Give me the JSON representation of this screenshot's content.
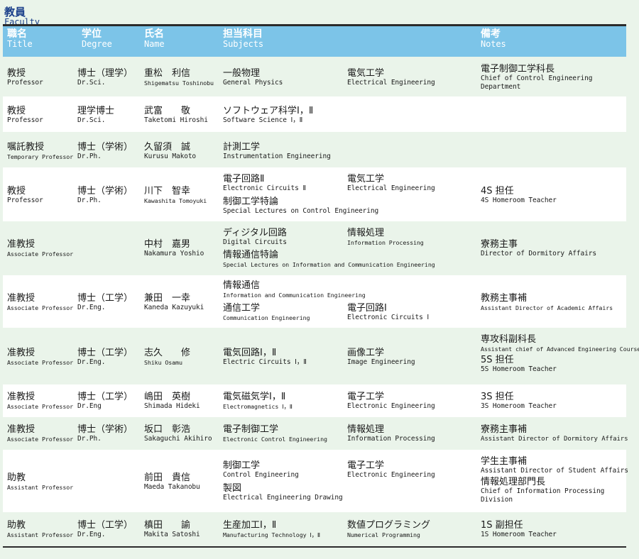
{
  "heading": {
    "ja": "教員",
    "en": "Faculty"
  },
  "columns": [
    {
      "ja": "職名",
      "en": "Title"
    },
    {
      "ja": "学位",
      "en": "Degree"
    },
    {
      "ja": "氏名",
      "en": "Name"
    },
    {
      "ja": "担当科目",
      "en": "Subjects"
    },
    {
      "ja": "備考",
      "en": "Notes"
    }
  ],
  "rows": [
    {
      "title": {
        "ja": "教授",
        "en": "Professor"
      },
      "degree": {
        "ja": "博士（理学）",
        "en": "Dr.Sci."
      },
      "name": {
        "ja": "重松　利信",
        "en": "Shigematsu Toshinobu"
      },
      "subjects": [
        {
          "ja": "一般物理",
          "en": "General Physics"
        },
        {
          "ja": "電気工学",
          "en": "Electrical Engineering"
        }
      ],
      "notes": [
        {
          "ja": "電子制御工学科長",
          "en": "Chief of Control Engineering Department"
        }
      ]
    },
    {
      "title": {
        "ja": "教授",
        "en": "Professor"
      },
      "degree": {
        "ja": "理学博士",
        "en": "Dr.Sci."
      },
      "name": {
        "ja": "武富　　敬",
        "en": "Taketomi Hiroshi"
      },
      "subjects": [
        {
          "ja": "ソフトウェア科学Ⅰ，Ⅱ",
          "en": "Software Science Ⅰ，Ⅱ"
        }
      ],
      "notes": []
    },
    {
      "title": {
        "ja": "嘱託教授",
        "en": "Temporary Professor"
      },
      "degree": {
        "ja": "博士（学術）",
        "en": "Dr.Ph."
      },
      "name": {
        "ja": "久留須　誠",
        "en": "Kurusu Makoto"
      },
      "subjects": [
        {
          "ja": "計測工学",
          "en": "Instrumentation Engineering"
        }
      ],
      "notes": []
    },
    {
      "title": {
        "ja": "教授",
        "en": "Professor"
      },
      "degree": {
        "ja": "博士（学術）",
        "en": "Dr.Ph."
      },
      "name": {
        "ja": "川下　智幸",
        "en": "Kawashita Tomoyuki"
      },
      "subjects": [
        {
          "ja": "電子回路Ⅱ",
          "en": "Electronic Circuits Ⅱ"
        },
        {
          "ja": "電気工学",
          "en": "Electrical Engineering"
        },
        {
          "ja": "制御工学特論",
          "en": "Special Lectures on Control Engineering"
        }
      ],
      "notes": [
        {
          "ja": "4S 担任",
          "en": "4S Homeroom Teacher"
        }
      ]
    },
    {
      "title": {
        "ja": "准教授",
        "en": "Associate Professor"
      },
      "degree": {
        "ja": "",
        "en": ""
      },
      "name": {
        "ja": "中村　嘉男",
        "en": "Nakamura Yoshio"
      },
      "subjects": [
        {
          "ja": "ディジタル回路",
          "en": "Digital Circuits"
        },
        {
          "ja": "情報処理",
          "en": "Information Processing"
        },
        {
          "ja": "情報通信特論",
          "en": "Special Lectures on Information and Communication Engineering"
        }
      ],
      "notes": [
        {
          "ja": "寮務主事",
          "en": "Director of Dormitory Affairs"
        }
      ]
    },
    {
      "title": {
        "ja": "准教授",
        "en": "Associate Professor"
      },
      "degree": {
        "ja": "博士（工学）",
        "en": "Dr.Eng."
      },
      "name": {
        "ja": "兼田　一幸",
        "en": "Kaneda Kazuyuki"
      },
      "subjects": [
        {
          "ja": "情報通信",
          "en": "Information and Communication Engineering"
        },
        {
          "ja": "通信工学",
          "en": "Communication Engineering"
        },
        {
          "ja": "電子回路Ⅰ",
          "en": "Electronic Circuits Ⅰ"
        }
      ],
      "notes": [
        {
          "ja": "教務主事補",
          "en": "Assistant Director of Academic Affairs"
        }
      ]
    },
    {
      "title": {
        "ja": "准教授",
        "en": "Associate Professor"
      },
      "degree": {
        "ja": "博士（工学）",
        "en": "Dr.Eng."
      },
      "name": {
        "ja": "志久　　修",
        "en": "Shiku Osamu"
      },
      "subjects": [
        {
          "ja": "電気回路Ⅰ，Ⅱ",
          "en": "Electric Circuits Ⅰ，Ⅱ"
        },
        {
          "ja": "画像工学",
          "en": "Image Engineering"
        }
      ],
      "notes": [
        {
          "ja": "専攻科副科長",
          "en": "Assistant chief of Advanced Engineering Course"
        },
        {
          "ja": "5S 担任",
          "en": "5S Homeroom Teacher"
        }
      ]
    },
    {
      "title": {
        "ja": "准教授",
        "en": "Associate Professor"
      },
      "degree": {
        "ja": "博士（工学）",
        "en": "Dr.Eng"
      },
      "name": {
        "ja": "嶋田　英樹",
        "en": "Shimada Hideki"
      },
      "subjects": [
        {
          "ja": "電気磁気学Ⅰ，Ⅱ",
          "en": "Electromagnetics Ⅰ，Ⅱ"
        },
        {
          "ja": "電子工学",
          "en": "Electronic Engineering"
        }
      ],
      "notes": [
        {
          "ja": "3S 担任",
          "en": "3S Homeroom Teacher"
        }
      ]
    },
    {
      "title": {
        "ja": "准教授",
        "en": "Associate Professor"
      },
      "degree": {
        "ja": "博士（学術）",
        "en": "Dr.Ph."
      },
      "name": {
        "ja": "坂口　彰浩",
        "en": "Sakaguchi Akihiro"
      },
      "subjects": [
        {
          "ja": "電子制御工学",
          "en": "Electronic Control Engineering"
        },
        {
          "ja": "情報処理",
          "en": "Information Processing"
        }
      ],
      "notes": [
        {
          "ja": "寮務主事補",
          "en": "Assistant Director of Dormitory Affairs"
        }
      ]
    },
    {
      "title": {
        "ja": "助教",
        "en": "Assistant Professor"
      },
      "degree": {
        "ja": "",
        "en": ""
      },
      "name": {
        "ja": "前田　貴信",
        "en": "Maeda Takanobu"
      },
      "subjects": [
        {
          "ja": "制御工学",
          "en": "Control Engineering"
        },
        {
          "ja": "電子工学",
          "en": "Electronic Engineering"
        },
        {
          "ja": "製図",
          "en": "Electrical Engineering Drawing"
        }
      ],
      "notes": [
        {
          "ja": "学生主事補",
          "en": "Assistant Director of Student Affairs"
        },
        {
          "ja": "情報処理部門長",
          "en": "Chief of Information Processing Division"
        }
      ]
    },
    {
      "title": {
        "ja": "助教",
        "en": "Assistant Professor"
      },
      "degree": {
        "ja": "博士（工学）",
        "en": "Dr.Eng."
      },
      "name": {
        "ja": "槙田　　諭",
        "en": "Makita Satoshi"
      },
      "subjects": [
        {
          "ja": "生産加工Ⅰ，Ⅱ",
          "en": "Manufacturing Technology Ⅰ，Ⅱ"
        },
        {
          "ja": "数値プログラミング",
          "en": "Numerical Programming"
        }
      ],
      "notes": [
        {
          "ja": "1S 副担任",
          "en": "1S Homeroom Teacher"
        }
      ]
    }
  ]
}
